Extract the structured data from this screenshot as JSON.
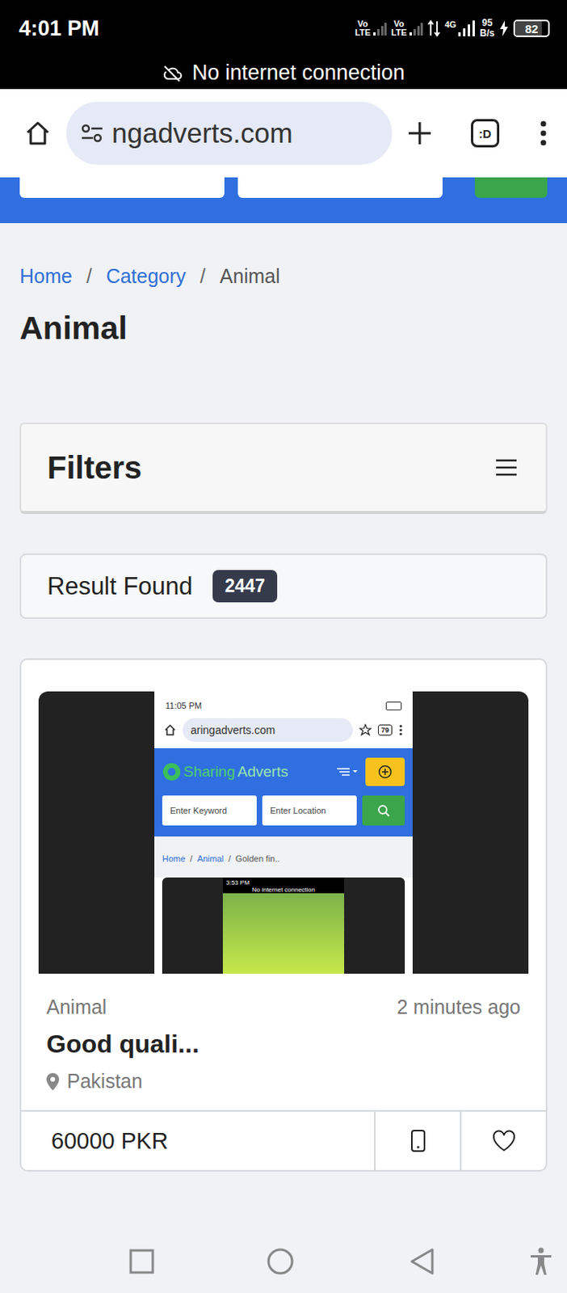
{
  "status_bar": {
    "time": "4:01 PM",
    "networks": [
      {
        "top": "Vo",
        "bottom": "LTE"
      },
      {
        "top": "Vo",
        "bottom": "LTE"
      }
    ],
    "data_type": "4G",
    "speed": {
      "top": "95",
      "bottom": "B/s"
    },
    "battery": {
      "text": "82",
      "level": 0.82,
      "charging": true
    }
  },
  "offline_banner": {
    "text": "No internet connection"
  },
  "browser": {
    "url": "ngadverts.com",
    "tab_switcher": ":D"
  },
  "breadcrumb": [
    {
      "label": "Home",
      "link": true
    },
    {
      "label": "Category",
      "link": true
    },
    {
      "label": "Animal",
      "link": false
    }
  ],
  "separator": "/",
  "page_title": "Animal",
  "filters": {
    "title": "Filters"
  },
  "results": {
    "label": "Result Found",
    "count": "2447"
  },
  "listings": [
    {
      "category": "Animal",
      "time": "2 minutes ago",
      "title": "Good quali...",
      "location": "Pakistan",
      "price": "60000 PKR",
      "favorite": false,
      "image": {
        "status_time": "11:05 PM",
        "url": "aringadverts.com",
        "tab_count": "79",
        "logo": {
          "part1": "Sharing",
          "part2": "Adverts"
        },
        "keyword_placeholder": "Enter Keyword",
        "location_placeholder": "Enter Location",
        "breadcrumb": [
          "Home",
          "Animal",
          "Golden fin.."
        ],
        "inner_status_time": "3:53 PM",
        "inner_banner": "No internet connection"
      }
    }
  ]
}
